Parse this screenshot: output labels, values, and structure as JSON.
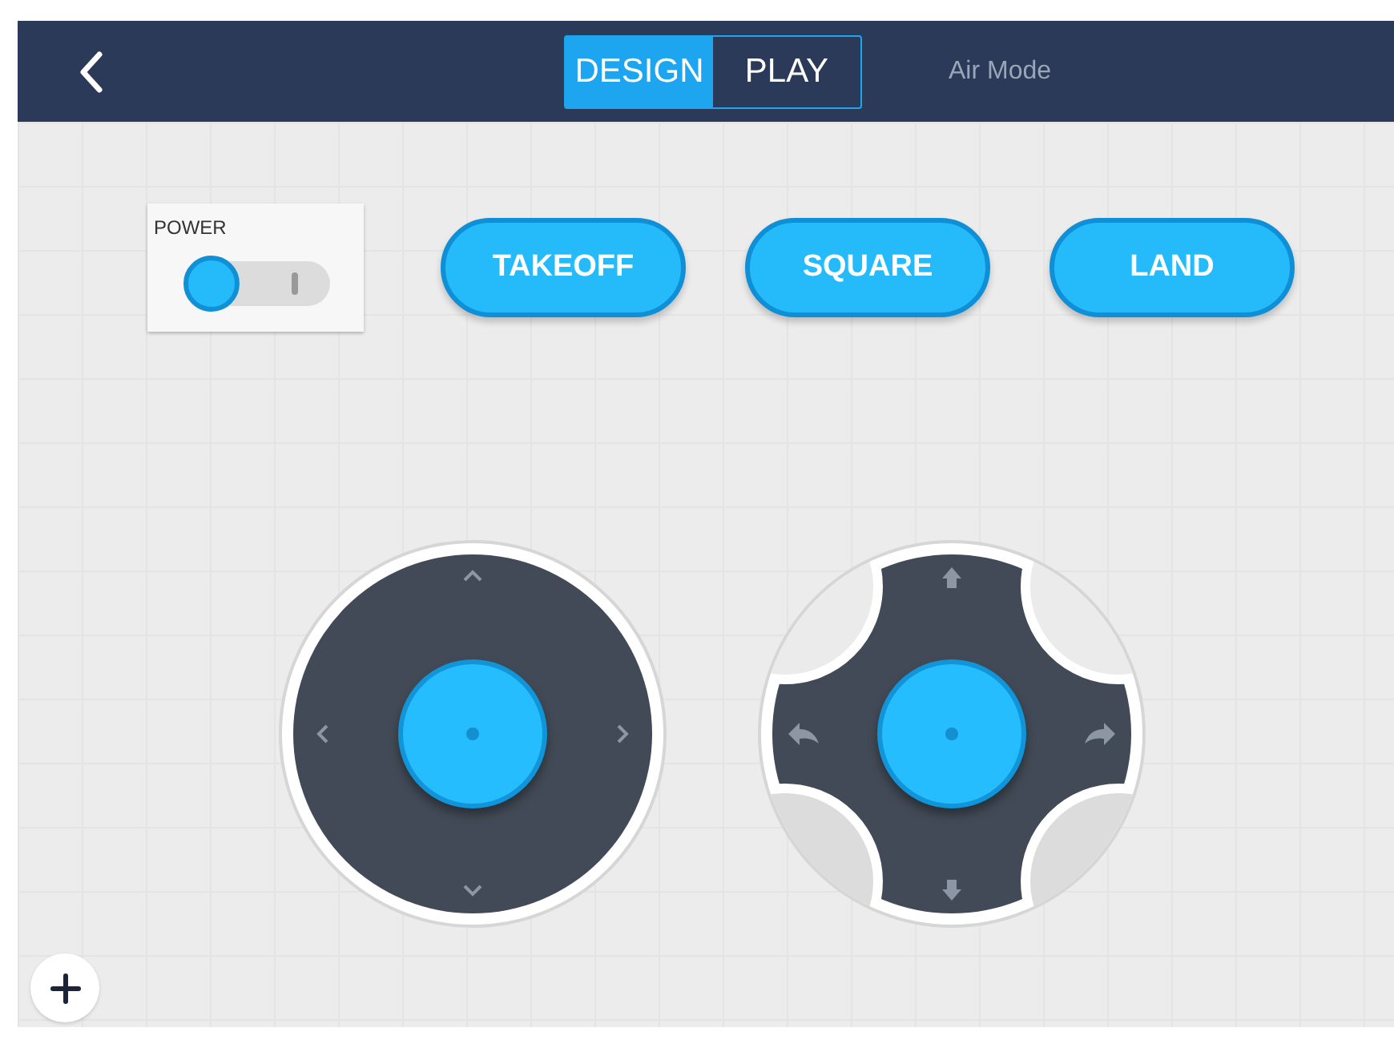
{
  "header": {
    "modes": [
      {
        "label": "DESIGN",
        "selected": true
      },
      {
        "label": "PLAY",
        "selected": false
      }
    ],
    "subtitle": "Air Mode"
  },
  "power": {
    "label": "POWER",
    "on": false
  },
  "buttons": [
    "TAKEOFF",
    "SQUARE",
    "LAND"
  ],
  "joysticks": [
    {
      "kind": "directional"
    },
    {
      "kind": "rotation"
    }
  ]
}
